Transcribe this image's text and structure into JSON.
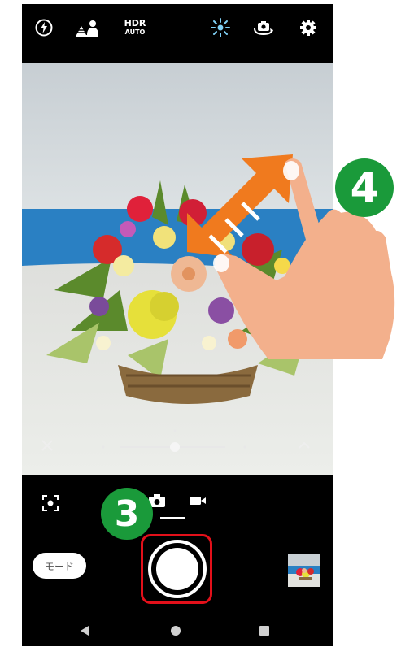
{
  "top_bar": {
    "flash_icon": "flash-auto-icon",
    "scene_icon": "scene-mode-icon",
    "hdr_line1": "HDR",
    "hdr_line2": "AUTO",
    "brightness_icon": "brightness-icon",
    "switch_camera_icon": "switch-camera-icon",
    "settings_icon": "gear-icon"
  },
  "viewfinder": {
    "close_icon": "close-icon",
    "zoom_slider_level": 0.45,
    "expand_icon": "chevron-up-icon"
  },
  "controls": {
    "lens_icon": "lens-icon",
    "photo_tab_icon": "camera-icon",
    "video_tab_icon": "video-icon",
    "mode_label": "モード",
    "shutter_icon": "shutter-button",
    "thumbnail": "last-photo-thumbnail"
  },
  "nav": {
    "back_icon": "back-icon",
    "home_icon": "home-icon",
    "recents_icon": "recents-icon"
  },
  "annotations": {
    "step3": "3",
    "step4": "4",
    "highlight_color": "#e3101a",
    "badge_color": "#1a9a3a",
    "arrow_color": "#f07a1e"
  }
}
